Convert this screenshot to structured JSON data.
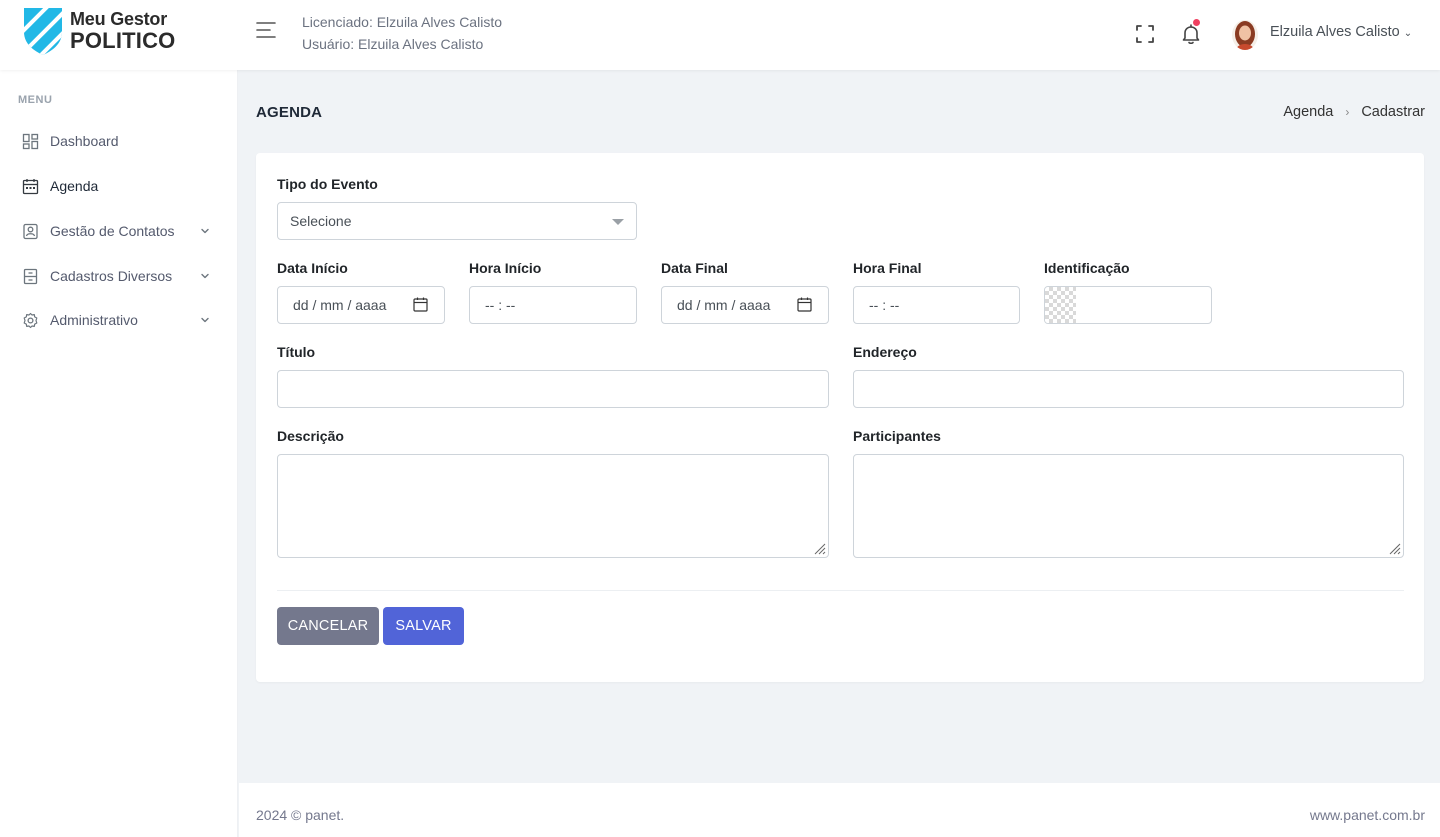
{
  "brand": {
    "line1": "Meu Gestor",
    "line2": "POLITICO",
    "shield_color": "#22b8e6"
  },
  "header": {
    "license_text": "Licenciado: Elzuila Alves Calisto",
    "user_text": "Usuário: Elzuila Alves Calisto",
    "profile_name": "Elzuila Alves Calisto",
    "notification_dot_color": "#ef4060"
  },
  "sidebar": {
    "menu_title": "MENU",
    "items": [
      {
        "label": "Dashboard",
        "icon": "dashboard-icon",
        "has_submenu": false
      },
      {
        "label": "Agenda",
        "icon": "calendar-icon",
        "has_submenu": false,
        "active": true
      },
      {
        "label": "Gestão de Contatos",
        "icon": "contacts-icon",
        "has_submenu": true
      },
      {
        "label": "Cadastros Diversos",
        "icon": "records-icon",
        "has_submenu": true
      },
      {
        "label": "Administrativo",
        "icon": "gear-icon",
        "has_submenu": true
      }
    ]
  },
  "page": {
    "title": "AGENDA",
    "breadcrumb": [
      "Agenda",
      "Cadastrar"
    ]
  },
  "form": {
    "tipo_evento": {
      "label": "Tipo do Evento",
      "value": "Selecione"
    },
    "data_inicio": {
      "label": "Data Início",
      "placeholder": "dd / mm / aaaa"
    },
    "hora_inicio": {
      "label": "Hora Início",
      "placeholder": "-- : --"
    },
    "data_final": {
      "label": "Data Final",
      "placeholder": "dd / mm / aaaa"
    },
    "hora_final": {
      "label": "Hora Final",
      "placeholder": "-- : --"
    },
    "identificacao": {
      "label": "Identificação"
    },
    "titulo": {
      "label": "Título",
      "value": ""
    },
    "endereco": {
      "label": "Endereço",
      "value": ""
    },
    "descricao": {
      "label": "Descrição",
      "value": ""
    },
    "participantes": {
      "label": "Participantes",
      "value": ""
    },
    "cancel_label": "CANCELAR",
    "save_label": "SALVAR",
    "cancel_color": "#74788d",
    "save_color": "#5164d8"
  },
  "footer": {
    "left": "2024 © panet.",
    "right": "www.panet.com.br"
  }
}
